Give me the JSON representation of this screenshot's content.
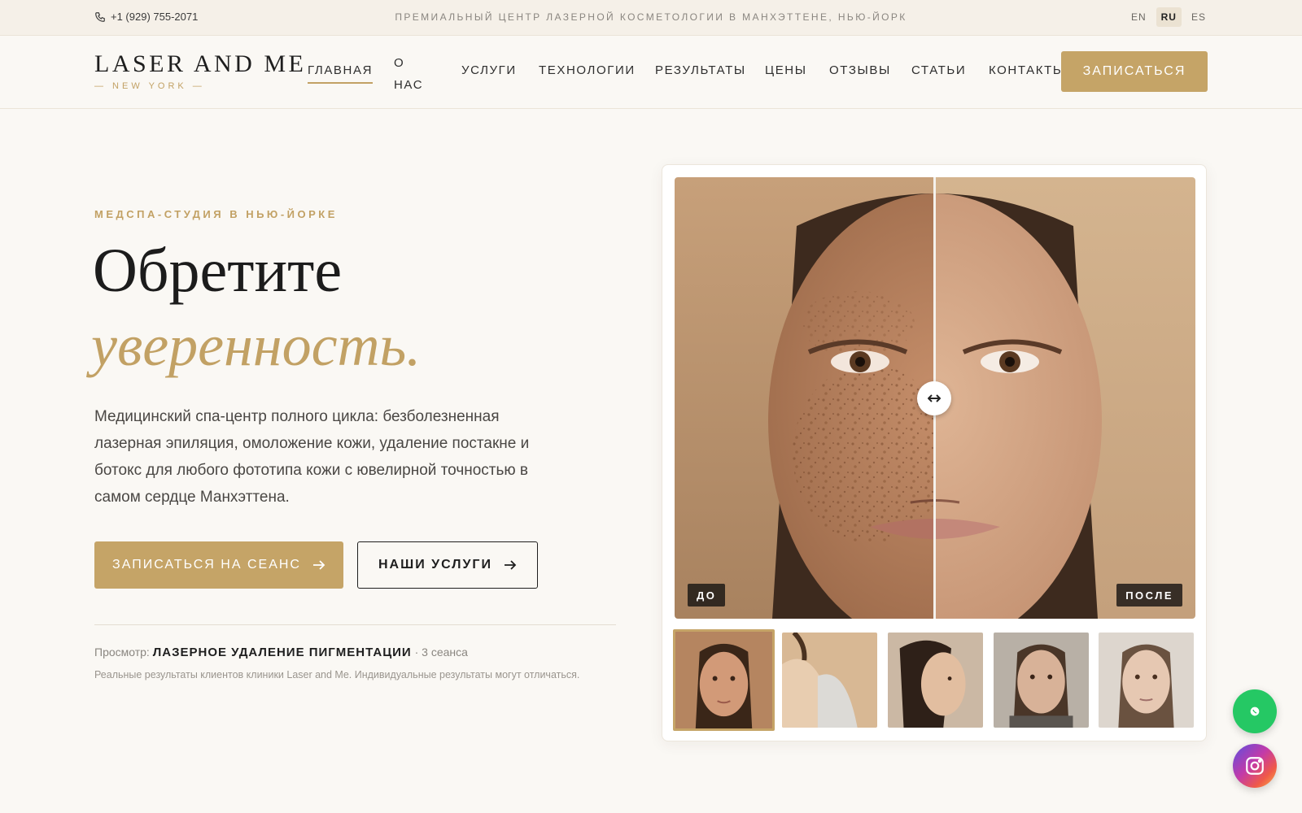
{
  "topbar": {
    "phone": "+1 (929) 755-2071",
    "tagline": "ПРЕМИАЛЬНЫЙ ЦЕНТР ЛАЗЕРНОЙ КОСМЕТОЛОГИИ В МАНХЭТТЕНЕ, НЬЮ-ЙОРК",
    "languages": [
      "EN",
      "RU",
      "ES"
    ],
    "active_language": "RU"
  },
  "header": {
    "logo": "LASER AND ME",
    "logo_sub": "— NEW YORK —",
    "nav": [
      "ГЛАВНАЯ",
      "О НАС",
      "УСЛУГИ",
      "ТЕХНОЛОГИИ",
      "РЕЗУЛЬТАТЫ",
      "ЦЕНЫ",
      "ОТЗЫВЫ",
      "СТАТЬИ",
      "КОНТАКТЫ"
    ],
    "active_nav": "ГЛАВНАЯ",
    "cta": "ЗАПИСАТЬСЯ"
  },
  "hero": {
    "eyebrow": "МЕДСПА-СТУДИЯ В НЬЮ-ЙОРКЕ",
    "title": "Обретите",
    "title_accent": "уверенность.",
    "lead": "Медицинский спа-центр полного цикла: безболезненная лазерная эпиляция, омоложение кожи, удаление постакне и ботокс для любого фототипа кожи с ювелирной точностью в самом сердце Манхэттена.",
    "primary_button": "ЗАПИСАТЬСЯ НА СЕАНС",
    "secondary_button": "НАШИ УСЛУГИ",
    "viewing_prefix": "Просмотр:",
    "viewing_treatment": "ЛАЗЕРНОЕ УДАЛЕНИЕ ПИГМЕНТАЦИИ",
    "viewing_suffix": "· 3 сеанса",
    "disclaimer": "Реальные результаты клиентов клиники Laser and Me. Индивидуальные результаты могут отличаться."
  },
  "comparison": {
    "before_label": "ДО",
    "after_label": "ПОСЛЕ",
    "slider_position": 0.5,
    "thumbnails": [
      "face-front",
      "underarm",
      "face-profile",
      "face-neutral",
      "face-soft"
    ],
    "active_thumbnail": 0
  },
  "floating": {
    "whatsapp_icon": "whatsapp-icon",
    "instagram_icon": "instagram-icon"
  },
  "colors": {
    "accent": "#c5a467",
    "background": "#faf8f4",
    "topbar": "#f5f0e8",
    "whatsapp": "#25c864"
  }
}
